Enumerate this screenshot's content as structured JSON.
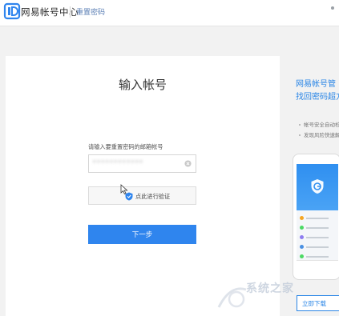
{
  "header": {
    "logo_letter": "D",
    "logo_text": "网易帐号中心",
    "nav_reset": "重置密码"
  },
  "form": {
    "title": "输入帐号",
    "field_label": "请输入要重置密码的邮箱帐号",
    "account_value": "••••••••••••",
    "verify_text": "点此进行验证",
    "next_label": "下一步"
  },
  "promo": {
    "title_line1": "网易帐号管",
    "title_line2": "找回密码超方",
    "features": [
      "帐号安全自动检测",
      "发现风险快速解决"
    ],
    "download_label": "立即下载",
    "watermark": "系统之家"
  },
  "colors": {
    "accent": "#2f85ee",
    "link": "#2b86e6",
    "background": "#f2f2f2"
  },
  "icons": {
    "logo": "netease-logo-icon",
    "clear": "clear-icon",
    "verify": "verify-icon",
    "cursor": "mouse-cursor-icon",
    "shield": "shield-icon"
  }
}
